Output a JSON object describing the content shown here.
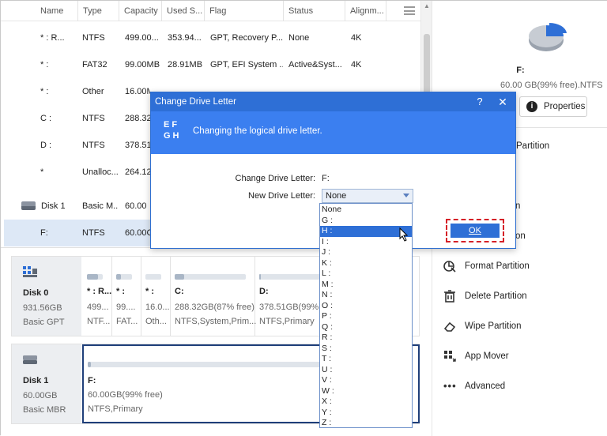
{
  "table": {
    "columns": [
      "Name",
      "Type",
      "Capacity",
      "Used S...",
      "Flag",
      "Status",
      "Alignm..."
    ],
    "rows": [
      {
        "name": "* : R...",
        "type": "NTFS",
        "capacity": "499.00...",
        "used": "353.94...",
        "flag": "GPT, Recovery P...",
        "status": "None",
        "align": "4K"
      },
      {
        "name": "* :",
        "type": "FAT32",
        "capacity": "99.00MB",
        "used": "28.91MB",
        "flag": "GPT, EFI System ...",
        "status": "Active&Syst...",
        "align": "4K"
      },
      {
        "name": "* :",
        "type": "Other",
        "capacity": "16.00M",
        "used": "",
        "flag": "",
        "status": "",
        "align": ""
      },
      {
        "name": "C :",
        "type": "NTFS",
        "capacity": "288.32",
        "used": "",
        "flag": "",
        "status": "",
        "align": ""
      },
      {
        "name": "D :",
        "type": "NTFS",
        "capacity": "378.51",
        "used": "",
        "flag": "",
        "status": "",
        "align": ""
      },
      {
        "name": "*",
        "type": "Unalloc...",
        "capacity": "264.12",
        "used": "",
        "flag": "",
        "status": "",
        "align": ""
      }
    ],
    "disk1_row": {
      "name": "Disk 1",
      "type": "Basic M...",
      "capacity": "60.00"
    },
    "selected_row": {
      "name": "F:",
      "type": "NTFS",
      "capacity": "60.00G"
    }
  },
  "diskmap": {
    "disk0": {
      "name": "Disk 0",
      "size": "931.56GB",
      "type": "Basic GPT",
      "partitions": [
        {
          "l1": "* : R...",
          "l2": "499...",
          "l3": "NTF...",
          "fill": 0.7
        },
        {
          "l1": "* :",
          "l2": "99....",
          "l3": "FAT...",
          "fill": 0.3
        },
        {
          "l1": "* :",
          "l2": "16.0...",
          "l3": "Oth...",
          "fill": 0.0
        },
        {
          "l1": "C:",
          "l2": "288.32GB(87% free)",
          "l3": "NTFS,System,Prim...",
          "fill": 0.13
        },
        {
          "l1": "D:",
          "l2": "378.51GB(99% free)",
          "l3": "NTFS,Primary",
          "fill": 0.01
        }
      ]
    },
    "disk1": {
      "name": "Disk 1",
      "size": "60.00GB",
      "type": "Basic MBR",
      "partitions": [
        {
          "l1": "F:",
          "l2": "60.00GB(99% free)",
          "l3": "NTFS,Primary",
          "fill": 0.01
        }
      ]
    }
  },
  "panel": {
    "drive_letter": "F:",
    "drive_info": "60.00 GB(99% free).NTFS",
    "properties_label": "Properties",
    "operations": [
      {
        "label": "Partition",
        "icon": "partition-icon"
      },
      {
        "label": "n",
        "icon": "partition-icon"
      },
      {
        "label": "on",
        "icon": "partition-icon"
      },
      {
        "label": "Format Partition",
        "icon": "format-icon"
      },
      {
        "label": "Delete Partition",
        "icon": "delete-icon"
      },
      {
        "label": "Wipe Partition",
        "icon": "wipe-icon"
      },
      {
        "label": "App Mover",
        "icon": "app-mover-icon"
      },
      {
        "label": "Advanced",
        "icon": "more-icon"
      }
    ]
  },
  "dialog": {
    "title": "Change Drive Letter",
    "help": "?",
    "close": "✕",
    "banner_icon": "EFGH",
    "banner_text": "Changing the logical drive letter.",
    "change_label": "Change Drive Letter:",
    "change_value": "F:",
    "new_label": "New Drive Letter:",
    "new_value": "None",
    "ok_label": "OK"
  },
  "dropdown": {
    "items": [
      "None",
      "G :",
      "H :",
      "I :",
      "J :",
      "K :",
      "L :",
      "M :",
      "N :",
      "O :",
      "P :",
      "Q :",
      "R :",
      "S :",
      "T :",
      "U :",
      "V :",
      "W :",
      "X :",
      "Y :",
      "Z :"
    ],
    "highlighted_index": 2
  },
  "colors": {
    "accent": "#2e6fd6",
    "selected_row": "#dde8f6",
    "highlight_border": "#d51f26"
  }
}
